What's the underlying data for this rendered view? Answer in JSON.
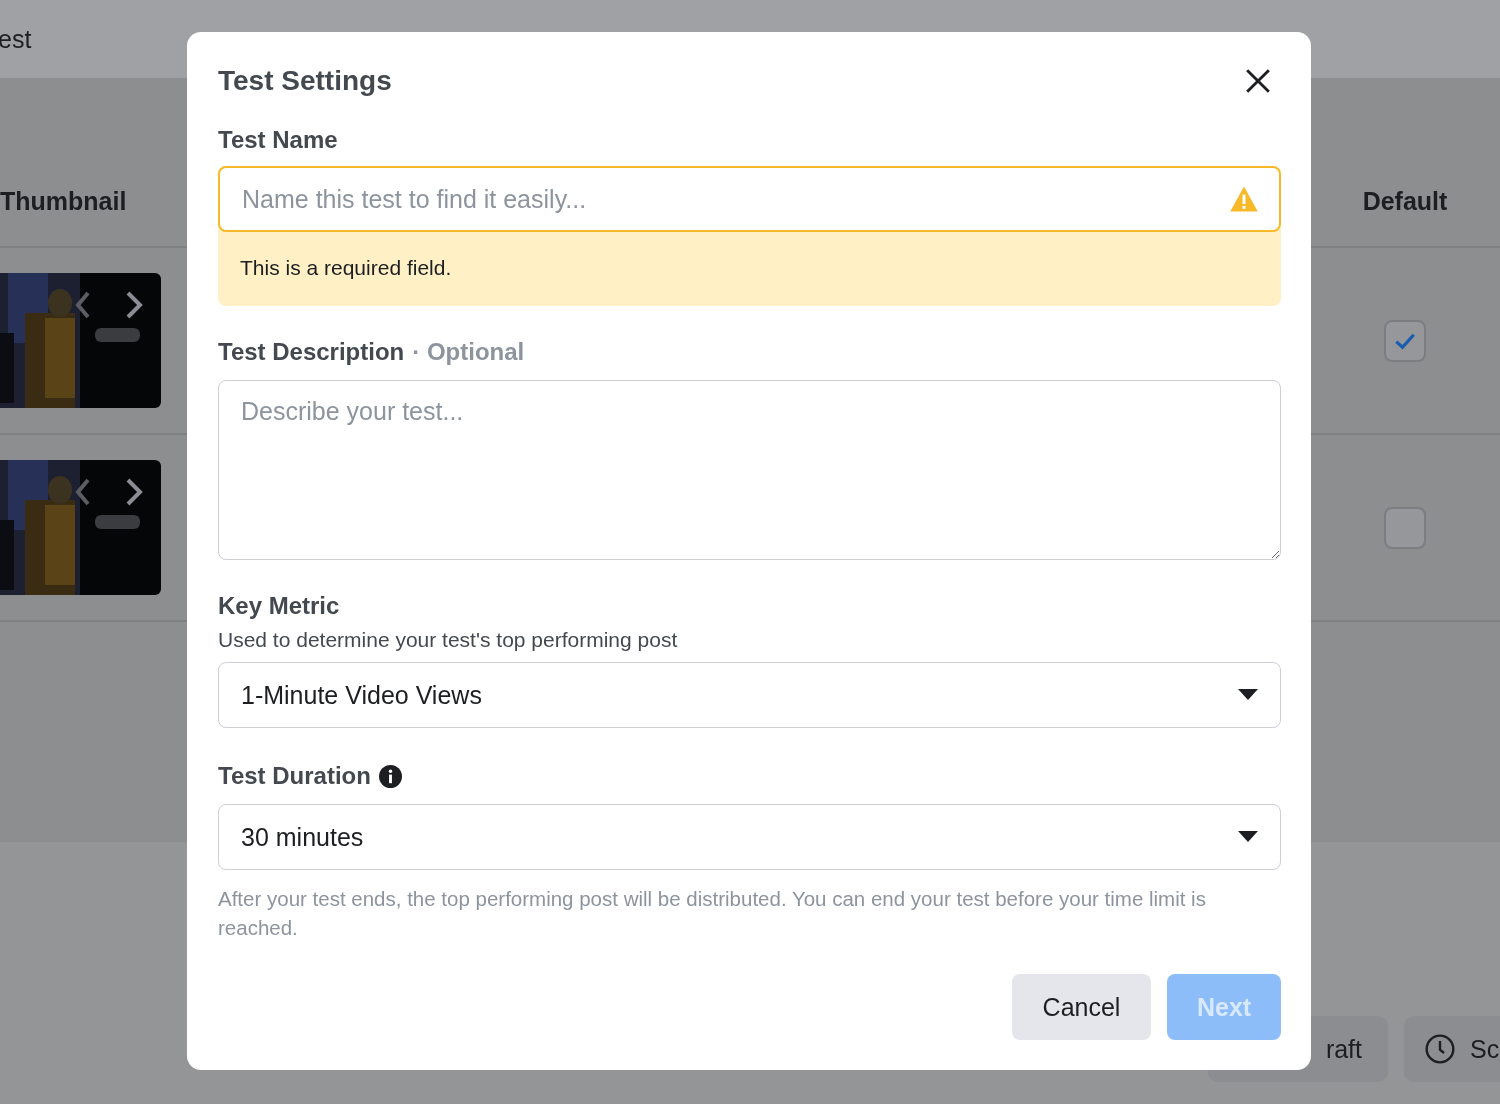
{
  "background": {
    "title": "est",
    "columns": [
      "Thumbnail",
      "Default"
    ],
    "rows": [
      {
        "checked": true
      },
      {
        "checked": false
      }
    ],
    "buttons": [
      {
        "label": "raft",
        "kind": "plain"
      },
      {
        "label": "Sc",
        "kind": "clock"
      }
    ]
  },
  "dialog": {
    "title": "Test Settings",
    "test_name": {
      "label": "Test Name",
      "placeholder": "Name this test to find it easily...",
      "warning": "This is a required field."
    },
    "description": {
      "label": "Test Description",
      "optional": "· Optional",
      "placeholder": "Describe your test..."
    },
    "key_metric": {
      "label": "Key Metric",
      "help": "Used to determine your test's top performing post",
      "value": "1-Minute Video Views"
    },
    "duration": {
      "label": "Test Duration",
      "value": "30 minutes",
      "note": "After your test ends, the top performing post will be distributed. You can end your test before your time limit is reached."
    },
    "buttons": [
      {
        "label": "Cancel",
        "kind": "secondary",
        "disabled": false
      },
      {
        "label": "Next",
        "kind": "primary",
        "disabled": true
      }
    ]
  }
}
